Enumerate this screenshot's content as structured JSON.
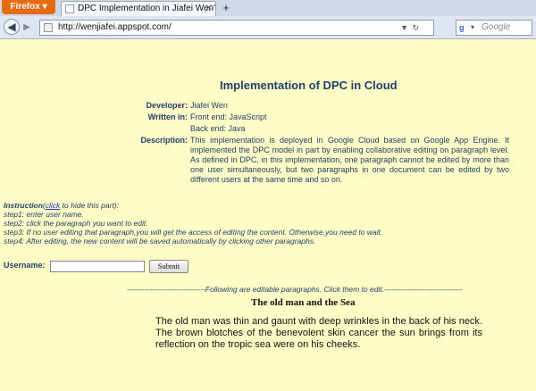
{
  "browser": {
    "menu_label": "Firefox",
    "tab_title": "DPC Implementation in Jiafei Wen's ...",
    "url": "http://wenjiafei.appspot.com/",
    "search_placeholder": "Google"
  },
  "page": {
    "title": "Implementation of DPC in Cloud",
    "developer_label": "Developer:",
    "developer": "Jiafei Wen",
    "written_label": "Written in:",
    "frontend": "Front end: JavaScript",
    "backend": "Back end: Java",
    "desc_label": "Description:",
    "description": "This implementation is deployed in Google Cloud based on Google App Engine. It implemented the DPC model in part by enabling collaborative editing on paragraph level. As defined in DPC, in this implementation, one paragraph cannot be edited by more than one user simultaneously, but two paragraphs in one document can be edited by two different users at the same time and so on."
  },
  "instructions": {
    "heading": "Instruction",
    "paren_open": "(",
    "link": "click",
    "suffix": " to hide this part):",
    "steps": [
      "step1: enter user name.",
      "step2: click the paragraph you want to edit.",
      "step3: If no user editing that paragraph,you will get the access of editing the content. Otherwise,you need to wait.",
      "step4: After editing, the new content will be saved automatically by clicking other paragraphs."
    ]
  },
  "form": {
    "username_label": "Username:",
    "username_value": "",
    "submit_label": "Submit"
  },
  "editable": {
    "separator": "-------------------------------Following are editable paragraphs. Click them to edit.-------------------------------",
    "title": "The old man and the Sea",
    "paragraph": "The old man was thin and gaunt with deep wrinkles in the back of his neck. The brown blotches of the benevolent skin cancer the sun brings from its reflection on the tropic sea were on his cheeks."
  }
}
